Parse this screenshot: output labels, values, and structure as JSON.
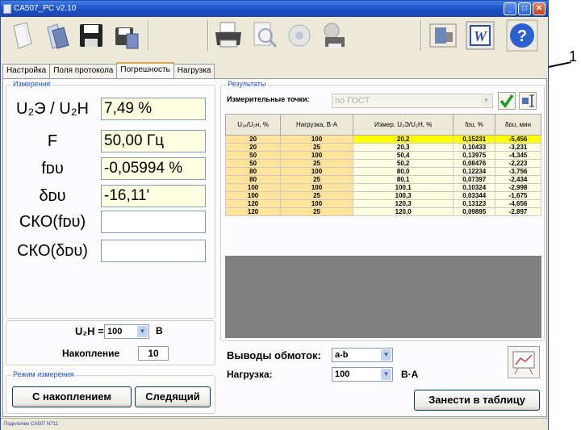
{
  "window": {
    "title": "CA507_PC v2.10"
  },
  "tabs": [
    "Настройка",
    "Поля протокола",
    "Погрешность",
    "Нагрузка"
  ],
  "active_tab": "Погрешность",
  "measurement": {
    "group_title": "Измерение",
    "rows": [
      {
        "label": "U₂Э / U₂Н",
        "value": "7,49 %"
      },
      {
        "label": "F",
        "value": "50,00 Гц"
      },
      {
        "label": "fᴅᴜ",
        "value": "-0,05994 %"
      },
      {
        "label": "δᴅᴜ",
        "value": "-16,11'"
      },
      {
        "label": "СКО(fᴅᴜ)",
        "value": ""
      },
      {
        "label": "СКО(δᴅᴜ)",
        "value": ""
      }
    ],
    "u2n_label": "U₂Н =",
    "u2n_value": "100",
    "u2n_unit": "В",
    "accumulation_label": "Накопление",
    "accumulation_value": "10"
  },
  "mode": {
    "group_title": "Режим измерения",
    "with_accumulation": "С накоплением",
    "tracking": "Следящий"
  },
  "results": {
    "group_title": "Результаты",
    "points_label": "Измерительные точки:",
    "points_value": "по ГОСТ",
    "columns": [
      "U₂ₓ/U₂н, %",
      "Нагрузка, В·А",
      "Измер. U₂Э/U₂Н, %",
      "fᴅᴜ, %",
      "δᴅᴜ, мин"
    ],
    "rows": [
      [
        "20",
        "100",
        "20,2",
        "0,15231",
        "-5,456"
      ],
      [
        "20",
        "25",
        "20,3",
        "0,10433",
        "-3,231"
      ],
      [
        "50",
        "100",
        "50,4",
        "0,13975",
        "-4,345"
      ],
      [
        "50",
        "25",
        "50,2",
        "0,08476",
        "-2,223"
      ],
      [
        "80",
        "100",
        "80,0",
        "0,12234",
        "-3,756"
      ],
      [
        "80",
        "25",
        "80,1",
        "0,07397",
        "-2,434"
      ],
      [
        "100",
        "100",
        "100,1",
        "0,10324",
        "-2,998"
      ],
      [
        "100",
        "25",
        "100,3",
        "0,03344",
        "-1,675"
      ],
      [
        "120",
        "100",
        "120,3",
        "0,13123",
        "-4,656"
      ],
      [
        "120",
        "25",
        "120,0",
        "0,09895",
        "-2,897"
      ]
    ],
    "windings_label": "Выводы обмоток:",
    "windings_value": "a-b",
    "load_label": "Нагрузка:",
    "load_value": "100",
    "load_unit": "В·А",
    "add_to_table": "Занести в таблицу"
  },
  "status": "Подключен CA507 N711",
  "callout": "1",
  "colors": {
    "accent": "#1d50d8",
    "value_bg": "#ffffe1",
    "selected_row": "#ffff00",
    "header_row": "#ffe39a"
  }
}
